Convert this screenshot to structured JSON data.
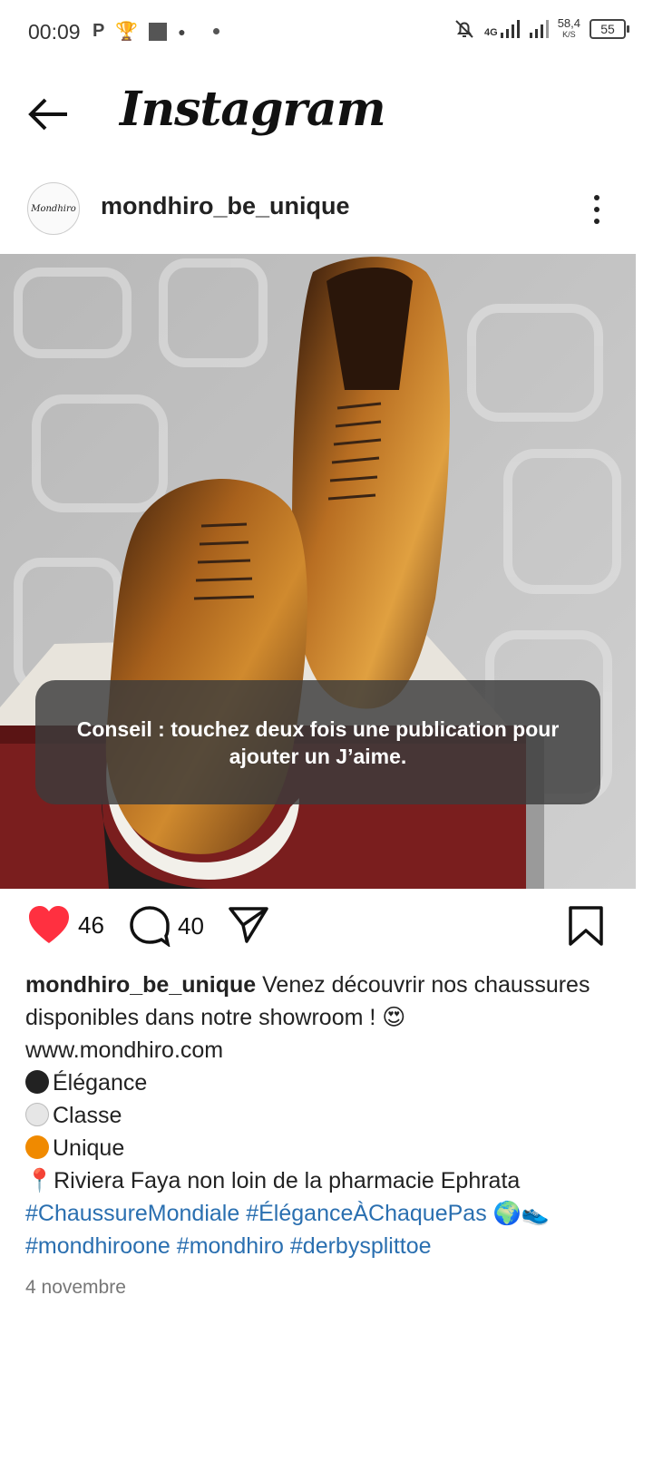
{
  "status_bar": {
    "time": "00:09",
    "network": "4G",
    "speed_value": "58,4",
    "speed_unit": "K/S",
    "battery": "55"
  },
  "header": {
    "app_title": "Instagram"
  },
  "post": {
    "username": "mondhiro_be_unique",
    "avatar_text": "Mondhiro",
    "toast": "Conseil : touchez deux fois une publication pour ajouter un J’aime.",
    "likes": "46",
    "comments": "40",
    "caption_user": "mondhiro_be_unique",
    "caption_text": "Venez découvrir nos chaussures disponibles dans notre showroom ! 😍",
    "website": "www.mondhiro.com",
    "lines": {
      "elegance": "Élégance",
      "classe": "Classe",
      "unique": "Unique",
      "location": "📍Riviera Faya non loin de la pharmacie Ephrata"
    },
    "hashtags": {
      "h1": "#ChaussureMondiale",
      "h2": "#ÉléganceÀChaquePas",
      "emojis": "🌍👟",
      "h3": "#mondhiroone",
      "h4": "#mondhiro",
      "h5": "#derbysplittoe"
    },
    "date": "4 novembre"
  },
  "colors": {
    "like_red": "#ff3040",
    "hashtag_blue": "#2a6fb0",
    "ball_black": "#222222",
    "ball_white": "#e6e6e6",
    "ball_orange": "#f08a00"
  }
}
